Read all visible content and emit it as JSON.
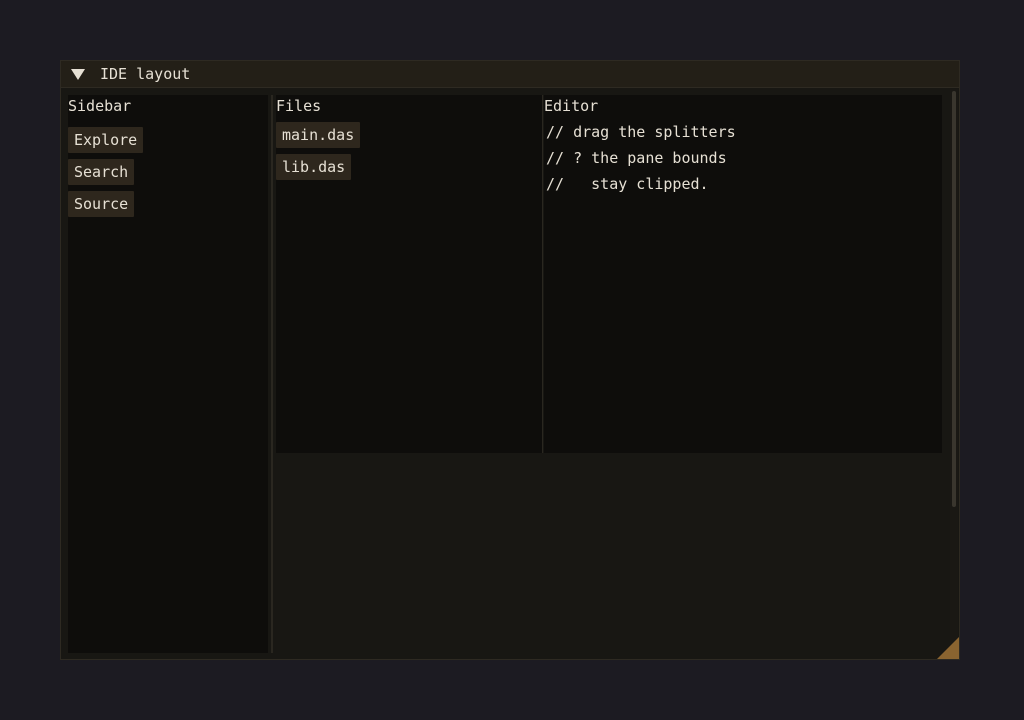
{
  "window": {
    "title": "IDE layout",
    "collapse_icon": "triangle-down-icon"
  },
  "sidebar": {
    "header": "Sidebar",
    "buttons": [
      {
        "label": "Explore"
      },
      {
        "label": "Search"
      },
      {
        "label": "Source"
      }
    ]
  },
  "files": {
    "header": "Files",
    "items": [
      {
        "label": "main.das"
      },
      {
        "label": "lib.das"
      }
    ]
  },
  "editor": {
    "header": "Editor",
    "lines": [
      "// drag the splitters",
      "// ? the pane bounds",
      "//   stay clipped."
    ]
  },
  "colors": {
    "background": "#1c1b22",
    "window_bg": "#181713",
    "titlebar_bg": "#231f17",
    "pane_bg": "#0e0d0b",
    "button_bg": "#2e271d",
    "text": "#e6e0d4",
    "resize_grip": "#8a6430"
  }
}
